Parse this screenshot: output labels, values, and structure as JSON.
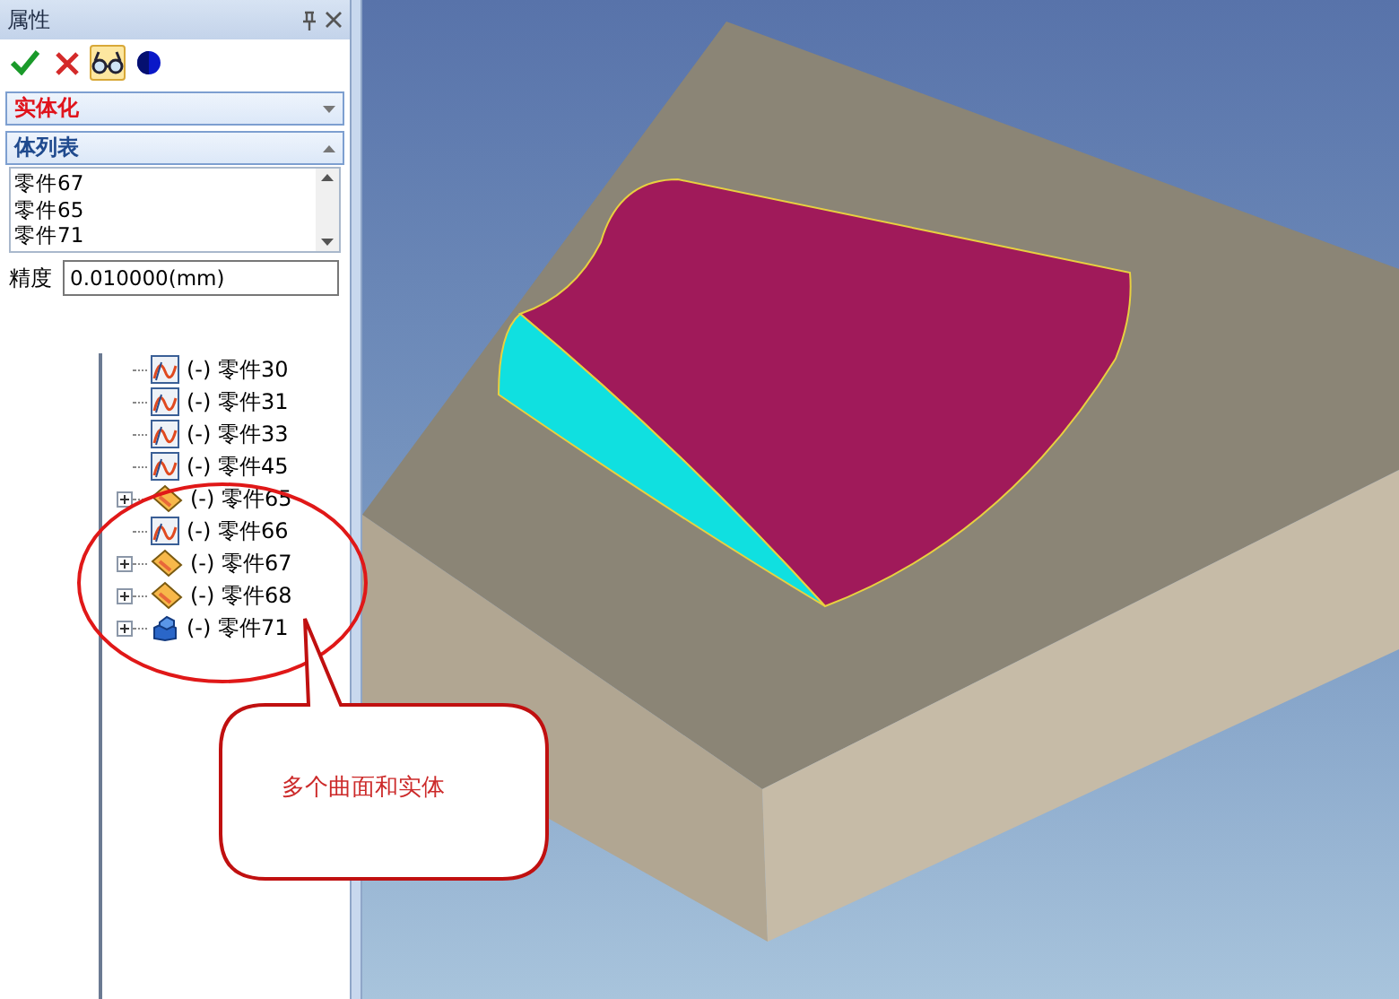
{
  "panel": {
    "title": "属性",
    "toolbar": [
      {
        "kind": "confirm",
        "selected": false
      },
      {
        "kind": "cancel",
        "selected": false
      },
      {
        "kind": "glasses",
        "selected": true
      },
      {
        "kind": "circle",
        "selected": false
      }
    ],
    "sections": [
      {
        "title": "实体化",
        "kind": "command",
        "expanded": false
      },
      {
        "title": "体列表",
        "kind": "group",
        "expanded": true,
        "items": [
          "零件67",
          "零件65",
          "零件71"
        ]
      }
    ],
    "precision": {
      "label": "精度",
      "value": "0.010000(mm)"
    }
  },
  "tree": {
    "items": [
      {
        "label": "(-) 零件30",
        "kind": "curve",
        "expandable": false
      },
      {
        "label": "(-) 零件31",
        "kind": "curve",
        "expandable": false
      },
      {
        "label": "(-) 零件33",
        "kind": "curve",
        "expandable": false
      },
      {
        "label": "(-) 零件45",
        "kind": "curve",
        "expandable": false
      },
      {
        "label": "(-) 零件65",
        "kind": "surface",
        "expandable": true
      },
      {
        "label": "(-) 零件66",
        "kind": "curve",
        "expandable": false
      },
      {
        "label": "(-) 零件67",
        "kind": "surface",
        "expandable": true
      },
      {
        "label": "(-) 零件68",
        "kind": "surface",
        "expandable": true
      },
      {
        "label": "(-) 零件71",
        "kind": "solid",
        "expandable": true
      }
    ]
  },
  "callout": {
    "text": "多个曲面和实体"
  }
}
